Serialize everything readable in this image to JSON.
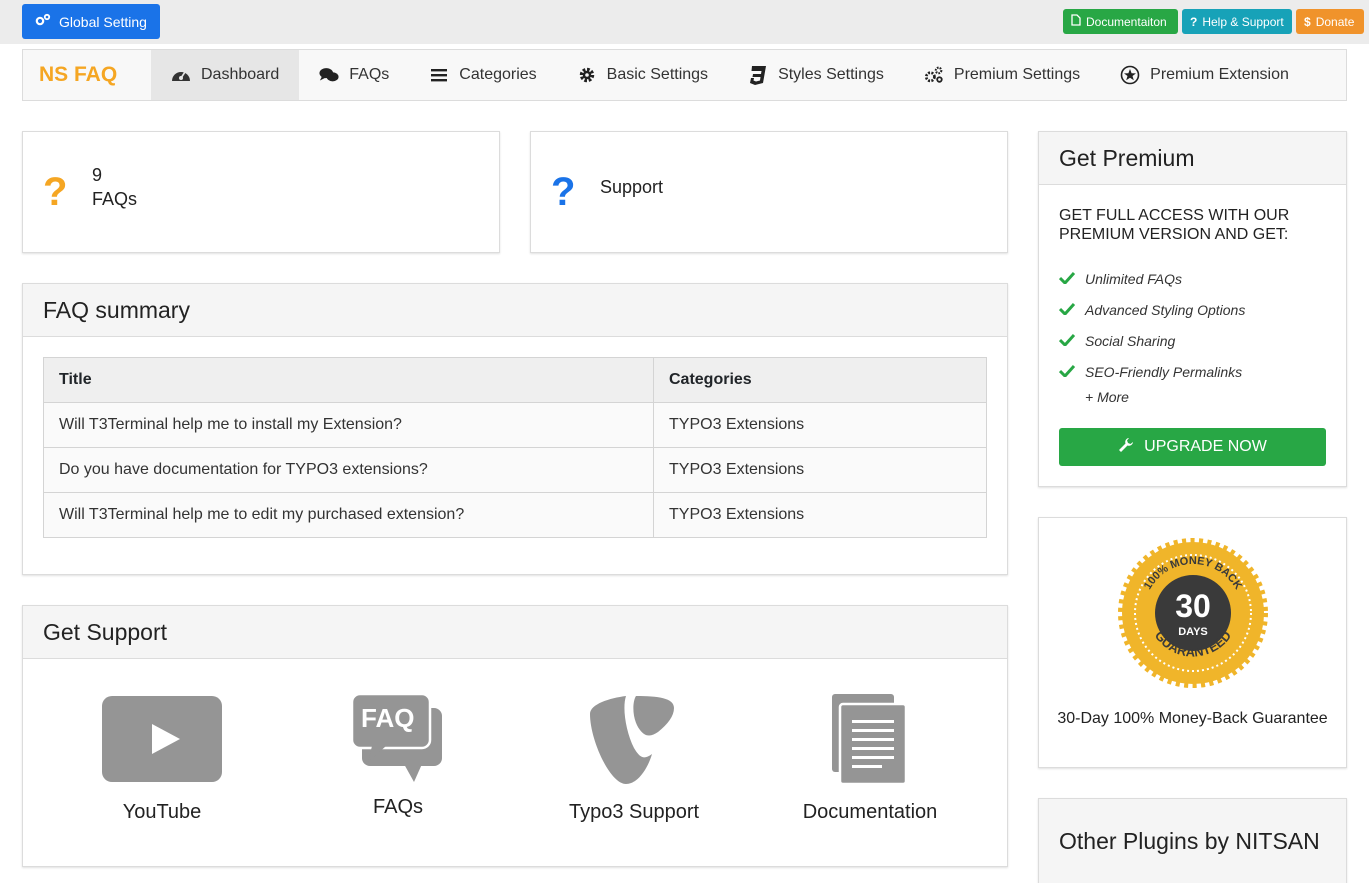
{
  "topbar": {
    "global_setting": "Global Setting",
    "documentation": "Documentaiton",
    "help_support": "Help & Support",
    "donate": "Donate"
  },
  "nav": {
    "brand": "NS FAQ",
    "items": [
      {
        "label": "Dashboard",
        "icon": "dashboard-icon"
      },
      {
        "label": "FAQs",
        "icon": "comments-icon"
      },
      {
        "label": "Categories",
        "icon": "list-icon"
      },
      {
        "label": "Basic Settings",
        "icon": "gear-icon"
      },
      {
        "label": "Styles Settings",
        "icon": "css3-icon"
      },
      {
        "label": "Premium Settings",
        "icon": "gears-icon"
      },
      {
        "label": "Premium Extension",
        "icon": "star-badge-icon"
      }
    ]
  },
  "stats": {
    "faq_count": "9",
    "faq_label": "FAQs",
    "support_label": "Support"
  },
  "summary": {
    "title": "FAQ summary",
    "columns": [
      "Title",
      "Categories"
    ],
    "rows": [
      [
        "Will T3Terminal help me to install my Extension?",
        "TYPO3 Extensions"
      ],
      [
        "Do you have documentation for TYPO3 extensions?",
        "TYPO3 Extensions"
      ],
      [
        "Will T3Terminal help me to edit my purchased extension?",
        "TYPO3 Extensions"
      ]
    ]
  },
  "support": {
    "title": "Get Support",
    "items": [
      "YouTube",
      "FAQs",
      "Typo3 Support",
      "Documentation"
    ],
    "faq_icon_text": "FAQ"
  },
  "premium": {
    "title": "Get Premium",
    "lead": "GET FULL ACCESS WITH OUR PREMIUM VERSION AND GET:",
    "features": [
      "Unlimited FAQs",
      "Advanced Styling Options",
      "Social Sharing",
      "SEO-Friendly Permalinks"
    ],
    "more": "+ More",
    "upgrade": "UPGRADE NOW"
  },
  "guarantee": {
    "caption": "30-Day 100% Money-Back Guarantee",
    "badge_number": "30",
    "badge_days": "DAYS",
    "badge_top": "100% MONEY BACK",
    "badge_bottom": "GUARANTEED"
  },
  "others": {
    "title": "Other Plugins by NITSAN"
  },
  "colors": {
    "primary": "#1a73e8",
    "success": "#28a745",
    "info": "#17a2b8",
    "warning": "#f0932b",
    "brand": "#f5a623"
  }
}
